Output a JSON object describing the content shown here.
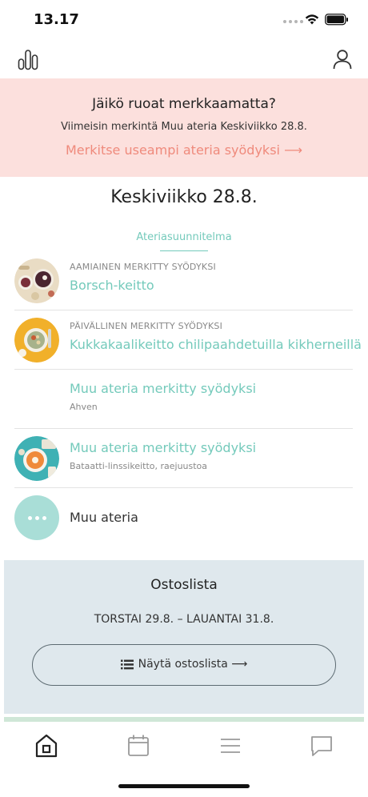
{
  "status_bar": {
    "time": "13.17"
  },
  "banner": {
    "title": "Jäikö ruoat merkkaamatta?",
    "text": "Viimeisin merkintä Muu ateria Keskiviikko 28.8.",
    "link": "Merkitse useampi ateria syödyksi ⟶"
  },
  "day": {
    "date_heading": "Keskiviikko 28.8.",
    "plan_label": "Ateriasuunnitelma"
  },
  "meals": [
    {
      "meta": "AAMIAINEN MERKITTY SYÖDYKSI",
      "name": "Borsch-keitto"
    },
    {
      "meta": "PÄIVÄLLINEN MERKITTY SYÖDYKSI",
      "name": "Kukkakaalikeitto chilipaahdetuilla kikherneillä"
    },
    {
      "name": "Muu ateria merkitty syödyksi",
      "sub": "Ahven"
    },
    {
      "name": "Muu ateria merkitty syödyksi",
      "sub": "Bataatti-linssikeitto, raejuustoa"
    },
    {
      "name": "Muu ateria"
    }
  ],
  "shopping_list": {
    "title": "Ostoslista",
    "dates": "TORSTAI 29.8. – LAUANTAI 31.8.",
    "button_label": "Näytä ostoslista ⟶"
  },
  "colors": {
    "accent": "#74cabb",
    "banner_bg": "#fce0dd",
    "banner_link": "#ef8a7c",
    "shopping_bg": "#dfe8ed"
  },
  "icons": {
    "header_left": "stats-icon",
    "header_right": "profile-icon",
    "tabs": [
      "home-icon",
      "calendar-icon",
      "menu-icon",
      "chat-icon"
    ]
  }
}
